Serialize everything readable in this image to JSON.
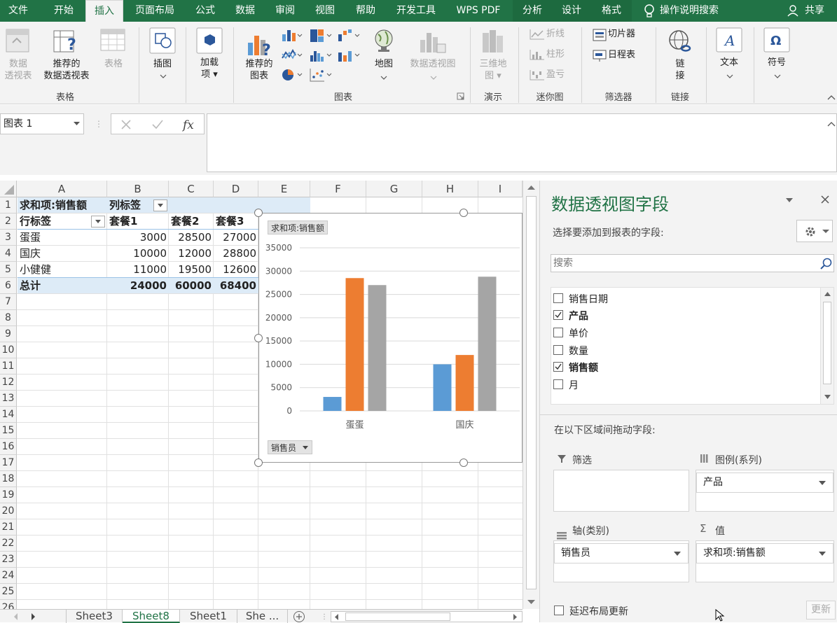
{
  "menu": {
    "tabs": [
      "文件",
      "开始",
      "插入",
      "页面布局",
      "公式",
      "数据",
      "审阅",
      "视图",
      "帮助",
      "开发工具",
      "WPS PDF",
      "分析",
      "设计",
      "格式"
    ],
    "tell_me": "操作说明搜索",
    "share": "共享"
  },
  "ribbon": {
    "pivot_table": [
      "数据",
      "透视表"
    ],
    "recommended_pivot": [
      "推荐的",
      "数据透视表"
    ],
    "table": "表格",
    "group_tables": "表格",
    "illustrations": "插图",
    "addins": [
      "加载",
      "项"
    ],
    "recommended_charts": [
      "推荐的",
      "图表"
    ],
    "map": "地图",
    "pivot_chart": "数据透视图",
    "group_charts": "图表",
    "map3d": [
      "三维地",
      "图"
    ],
    "group_tours": "演示",
    "sparkline_line": "折线",
    "sparkline_column": "柱形",
    "sparkline_winloss": "盈亏",
    "group_sparklines": "迷你图",
    "slicer": "切片器",
    "timeline": "日程表",
    "group_filters": "筛选器",
    "link": [
      "链",
      "接"
    ],
    "group_links": "链接",
    "text": "文本",
    "symbols": "符号"
  },
  "formula_bar": {
    "name_box": "图表 1",
    "formula": ""
  },
  "grid": {
    "columns": [
      "A",
      "B",
      "C",
      "D",
      "E",
      "F",
      "G",
      "H",
      "I"
    ],
    "rows": [
      "1",
      "2",
      "3",
      "4",
      "5",
      "6",
      "7",
      "8",
      "9",
      "10",
      "11",
      "12",
      "13",
      "14",
      "15",
      "16",
      "17",
      "18",
      "19",
      "20",
      "21",
      "22",
      "23",
      "24",
      "25",
      "26"
    ],
    "r1": {
      "a": "求和项:销售额",
      "b": "列标签"
    },
    "r2": {
      "a": "行标签",
      "b": "套餐1",
      "c": "套餐2",
      "d": "套餐3"
    },
    "r3": {
      "a": "蛋蛋",
      "b": "3000",
      "c": "28500",
      "d": "27000"
    },
    "r4": {
      "a": "国庆",
      "b": "10000",
      "c": "12000",
      "d": "28800"
    },
    "r5": {
      "a": "小健健",
      "b": "11000",
      "c": "19500",
      "d": "12600"
    },
    "r6": {
      "a": "总计",
      "b": "24000",
      "c": "60000",
      "d": "68400"
    }
  },
  "chart": {
    "value_button": "求和项:销售额",
    "axis_button": "销售员"
  },
  "chart_data": {
    "type": "bar",
    "categories": [
      "蛋蛋",
      "国庆"
    ],
    "series": [
      {
        "values": [
          3000,
          10000
        ],
        "color": "#5b9bd5"
      },
      {
        "values": [
          28500,
          12000
        ],
        "color": "#ed7d31"
      },
      {
        "values": [
          27000,
          28800
        ],
        "color": "#a5a5a5"
      }
    ],
    "yticks": [
      "0",
      "5000",
      "10000",
      "15000",
      "20000",
      "25000",
      "30000",
      "35000"
    ],
    "ylim": [
      0,
      35000
    ],
    "grid": true,
    "legend": "none"
  },
  "sheets": {
    "tabs": [
      "Sheet3",
      "Sheet8",
      "Sheet1",
      "She ..."
    ],
    "active": "Sheet8"
  },
  "panel": {
    "title": "数据透视图字段",
    "subtitle": "选择要添加到报表的字段:",
    "search_placeholder": "搜索",
    "fields": [
      {
        "label": "销售日期",
        "checked": false
      },
      {
        "label": "产品",
        "checked": true
      },
      {
        "label": "单价",
        "checked": false
      },
      {
        "label": "数量",
        "checked": false
      },
      {
        "label": "销售额",
        "checked": true
      },
      {
        "label": "月",
        "checked": false
      }
    ],
    "drag_label": "在以下区域间拖动字段:",
    "filter_label": "筛选",
    "legend_label": "图例(系列)",
    "legend_value": "产品",
    "axis_label": "轴(类别)",
    "axis_value": "销售员",
    "values_label": "值",
    "values_value": "求和项:销售额",
    "defer_label": "延迟布局更新",
    "update_button": "更新"
  }
}
